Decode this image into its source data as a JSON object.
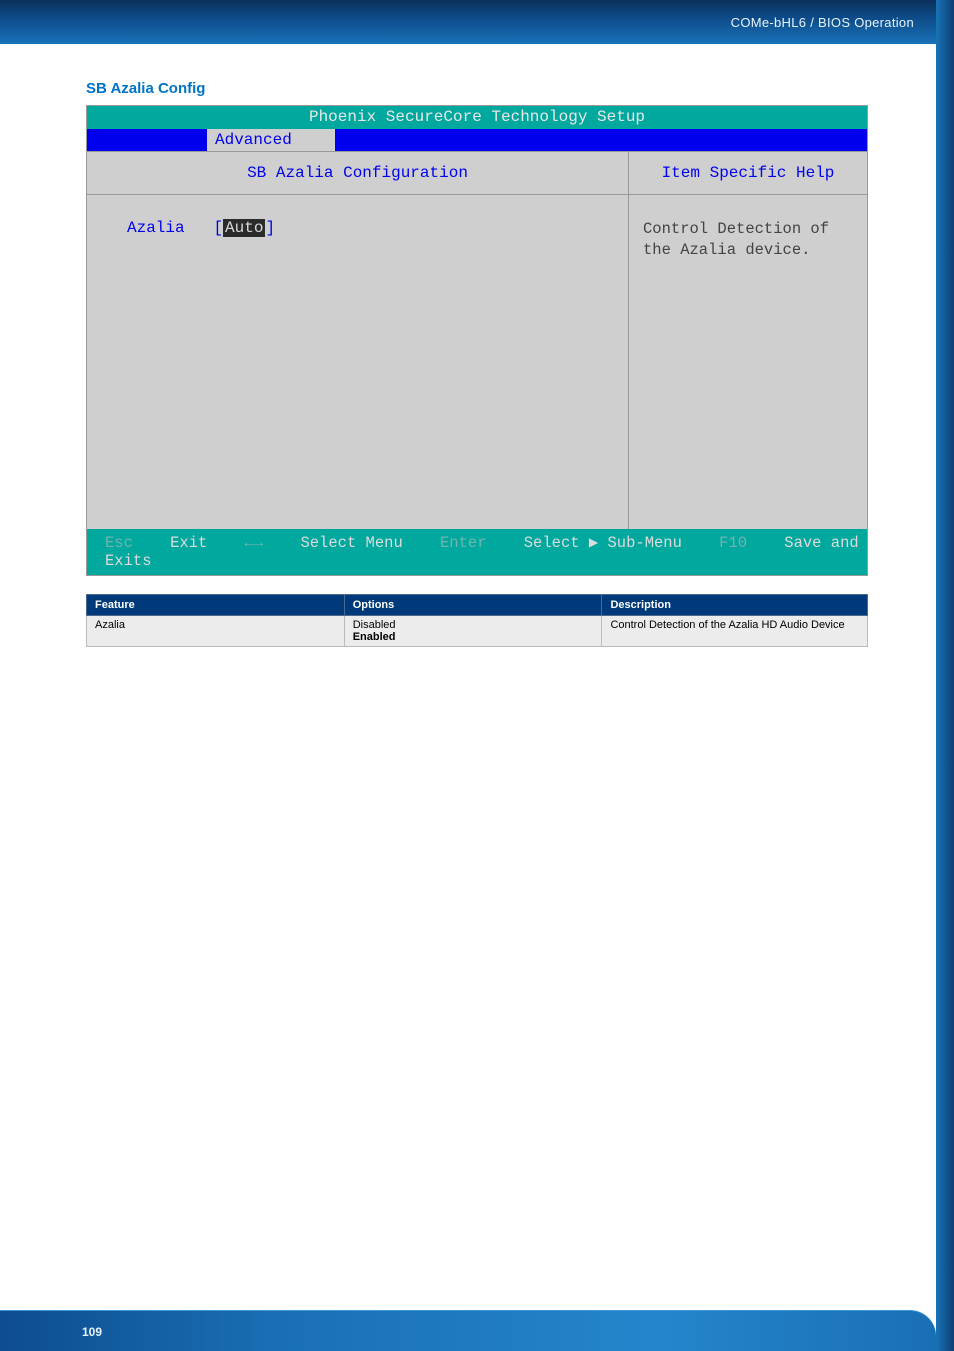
{
  "header": {
    "text": "COMe-bHL6 / BIOS Operation"
  },
  "section_title": "SB Azalia Config",
  "bios": {
    "screen_title": "Phoenix SecureCore Technology Setup",
    "tab_active": "Advanced",
    "left_title": "SB Azalia Configuration",
    "right_title": "Item Specific Help",
    "setting": {
      "label": "Azalia",
      "bracket_open": "[",
      "value": "Auto",
      "bracket_close": "]"
    },
    "help_line1": "Control Detection of",
    "help_line2": "the Azalia device.",
    "footer_view": "Esc  Exit  ←→  Select Menu  Enter  Select ▶ Sub-Menu  F10  Save and Exits",
    "footer": {
      "esc": "Esc",
      "exit": "Exit",
      "arrows": "←→",
      "select_menu": "Select Menu",
      "enter": "Enter",
      "select_sub": "Select ▶ Sub-Menu",
      "f10": "F10",
      "save": "Save and Exits"
    }
  },
  "table": {
    "headers": {
      "c1": "Feature",
      "c2": "Options",
      "c3": "Description"
    },
    "rows": [
      {
        "feature": "Azalia",
        "option1": "Disabled",
        "option2_bold": "Enabled",
        "description": "Control Detection of the Azalia HD Audio Device"
      }
    ]
  },
  "page_number": "109"
}
